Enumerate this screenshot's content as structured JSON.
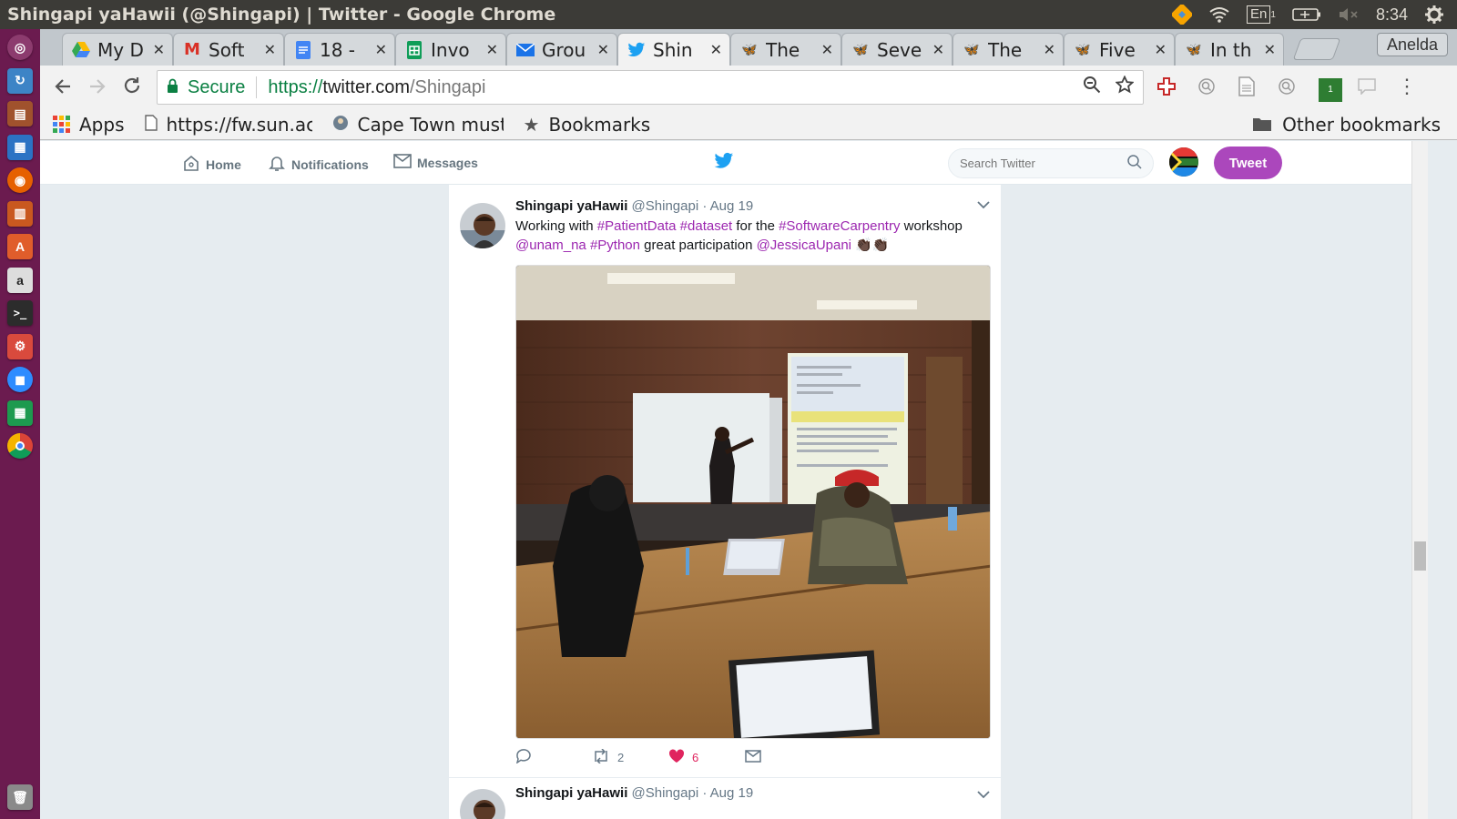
{
  "window": {
    "title": "Shingapi yaHawii (@Shingapi) | Twitter - Google Chrome",
    "keyboard": "En",
    "keyboard_sub": "1",
    "clock": "8:34"
  },
  "tabs": [
    {
      "label": "My D",
      "icon": "google-drive-icon"
    },
    {
      "label": "Soft",
      "icon": "gmail-icon"
    },
    {
      "label": "18 -",
      "icon": "google-docs-icon"
    },
    {
      "label": "Invo",
      "icon": "google-sheets-icon"
    },
    {
      "label": "Grou",
      "icon": "mail-icon"
    },
    {
      "label": "Shin",
      "icon": "twitter-icon",
      "active": true
    },
    {
      "label": "The",
      "icon": "butterfly-icon"
    },
    {
      "label": "Seve",
      "icon": "butterfly-icon"
    },
    {
      "label": "The",
      "icon": "butterfly-icon"
    },
    {
      "label": "Five",
      "icon": "butterfly-icon"
    },
    {
      "label": "In th",
      "icon": "butterfly-icon"
    }
  ],
  "profile_name": "Anelda",
  "omnibox": {
    "secure_label": "Secure",
    "scheme": "https://",
    "host": "twitter.com",
    "path": "/Shingapi"
  },
  "bookmarks": {
    "apps": "Apps",
    "items": [
      "https://fw.sun.ac",
      "Cape Town must",
      "Bookmarks"
    ],
    "other": "Other bookmarks"
  },
  "twitter_nav": {
    "home": "Home",
    "notifications": "Notifications",
    "messages": "Messages",
    "search_placeholder": "Search Twitter",
    "tweet_button": "Tweet"
  },
  "tweets": [
    {
      "name": "Shingapi yaHawii",
      "handle": "@Shingapi",
      "sep": "·",
      "time": "Aug 19",
      "text_parts": {
        "p1": "Working with ",
        "tag1": "#PatientData",
        "sp1": " ",
        "tag2": "#dataset",
        "p2": " for the ",
        "tag3": "#SoftwareCarpentry",
        "p3": " workshop",
        "tag4": "@unam_na",
        "sp2": " ",
        "tag5": "#Python",
        "p4": " great participation ",
        "tag6": "@JessicaUpani",
        "emoji": "👏🏿👏🏿"
      },
      "retweets": "2",
      "likes": "6"
    },
    {
      "name": "Shingapi yaHawii",
      "handle": "@Shingapi",
      "sep": "·",
      "time": "Aug 19"
    }
  ],
  "colors": {
    "accent": "#ab47bc",
    "hashtag": "#9c27b0",
    "like": "#e0245e",
    "launcher": "#6b1b4f"
  }
}
